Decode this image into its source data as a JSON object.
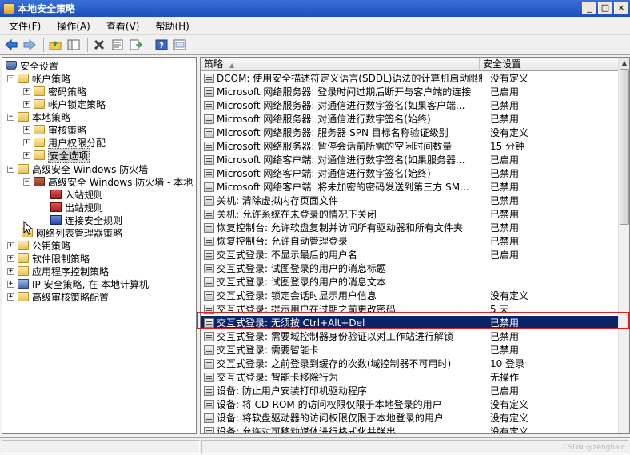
{
  "window": {
    "title": "本地安全策略",
    "controls": {
      "minimize": "_",
      "maximize": "□",
      "close": "×"
    }
  },
  "menu": [
    "文件(F)",
    "操作(A)",
    "查看(V)",
    "帮助(H)"
  ],
  "toolbar": {
    "icons": [
      "back-arrow-icon",
      "forward-arrow-icon",
      "up-folder-icon",
      "show-tree-icon",
      "delete-icon",
      "properties-icon",
      "export-list-icon",
      "help-icon",
      "console-icon"
    ]
  },
  "tree": {
    "root": "安全设置",
    "account_policy": "帐户策略",
    "password_policy": "密码策略",
    "lockout_policy": "帐户锁定策略",
    "local_policy": "本地策略",
    "audit_policy": "审核策略",
    "user_rights": "用户权限分配",
    "security_options": "安全选项",
    "wf": "高级安全 Windows 防火墙",
    "wf_local": "高级安全 Windows 防火墙 - 本地",
    "inbound": "入站规则",
    "outbound": "出站规则",
    "connection": "连接安全规则",
    "network_list": "网络列表管理器策略",
    "public_key": "公钥策略",
    "software_restriction": "软件限制策略",
    "app_control": "应用程序控制策略",
    "ipsec": "IP 安全策略, 在 本地计算机",
    "advanced_audit": "高级审核策略配置"
  },
  "list": {
    "col_policy": "策略",
    "col_setting": "安全设置",
    "rows": [
      {
        "name": "DCOM: 使用安全描述符定义语言(SDDL)语法的计算机启动限制",
        "value": "没有定义"
      },
      {
        "name": "Microsoft 网络服务器: 登录时间过期后断开与客户端的连接",
        "value": "已启用"
      },
      {
        "name": "Microsoft 网络服务器: 对通信进行数字签名(如果客户端...",
        "value": "已禁用"
      },
      {
        "name": "Microsoft 网络服务器: 对通信进行数字签名(始终)",
        "value": "已禁用"
      },
      {
        "name": "Microsoft 网络服务器: 服务器 SPN 目标名称验证级别",
        "value": "没有定义"
      },
      {
        "name": "Microsoft 网络服务器: 暂停会话前所需的空闲时间数量",
        "value": "15 分钟"
      },
      {
        "name": "Microsoft 网络客户端: 对通信进行数字签名(如果服务器...",
        "value": "已启用"
      },
      {
        "name": "Microsoft 网络客户端: 对通信进行数字签名(始终)",
        "value": "已禁用"
      },
      {
        "name": "Microsoft 网络客户端: 将未加密的密码发送到第三方 SM...",
        "value": "已禁用"
      },
      {
        "name": "关机: 清除虚拟内存页面文件",
        "value": "已禁用"
      },
      {
        "name": "关机: 允许系统在未登录的情况下关闭",
        "value": "已禁用"
      },
      {
        "name": "恢复控制台: 允许软盘复制并访问所有驱动器和所有文件夹",
        "value": "已禁用"
      },
      {
        "name": "恢复控制台: 允许自动管理登录",
        "value": "已禁用"
      },
      {
        "name": "交互式登录: 不显示最后的用户名",
        "value": "已启用"
      },
      {
        "name": "交互式登录: 试图登录的用户的消息标题",
        "value": ""
      },
      {
        "name": "交互式登录: 试图登录的用户的消息文本",
        "value": ""
      },
      {
        "name": "交互式登录: 锁定会话时显示用户信息",
        "value": "没有定义"
      },
      {
        "name": "交互式登录: 提示用户在过期之前更改密码",
        "value": "5 天"
      },
      {
        "name": "交互式登录: 无须按 Ctrl+Alt+Del",
        "value": "已禁用"
      },
      {
        "name": "交互式登录: 需要域控制器身份验证以对工作站进行解锁",
        "value": "已禁用"
      },
      {
        "name": "交互式登录: 需要智能卡",
        "value": "已禁用"
      },
      {
        "name": "交互式登录: 之前登录到缓存的次数(域控制器不可用时)",
        "value": "10 登录"
      },
      {
        "name": "交互式登录: 智能卡移除行为",
        "value": "无操作"
      },
      {
        "name": "设备: 防止用户安装打印机驱动程序",
        "value": "已启用"
      },
      {
        "name": "设备: 将 CD-ROM 的访问权限仅限于本地登录的用户",
        "value": "没有定义"
      },
      {
        "name": "设备: 将软盘驱动器的访问权限仅限于本地登录的用户",
        "value": "没有定义"
      },
      {
        "name": "设备: 允许对可移动媒体进行格式化并弹出",
        "value": "没有定义"
      }
    ]
  },
  "watermark": "CSDN @zengbaic",
  "colors": {
    "selection": "#0a246a",
    "highlight": "#e02020",
    "titlebar": "#1f4fb8"
  }
}
